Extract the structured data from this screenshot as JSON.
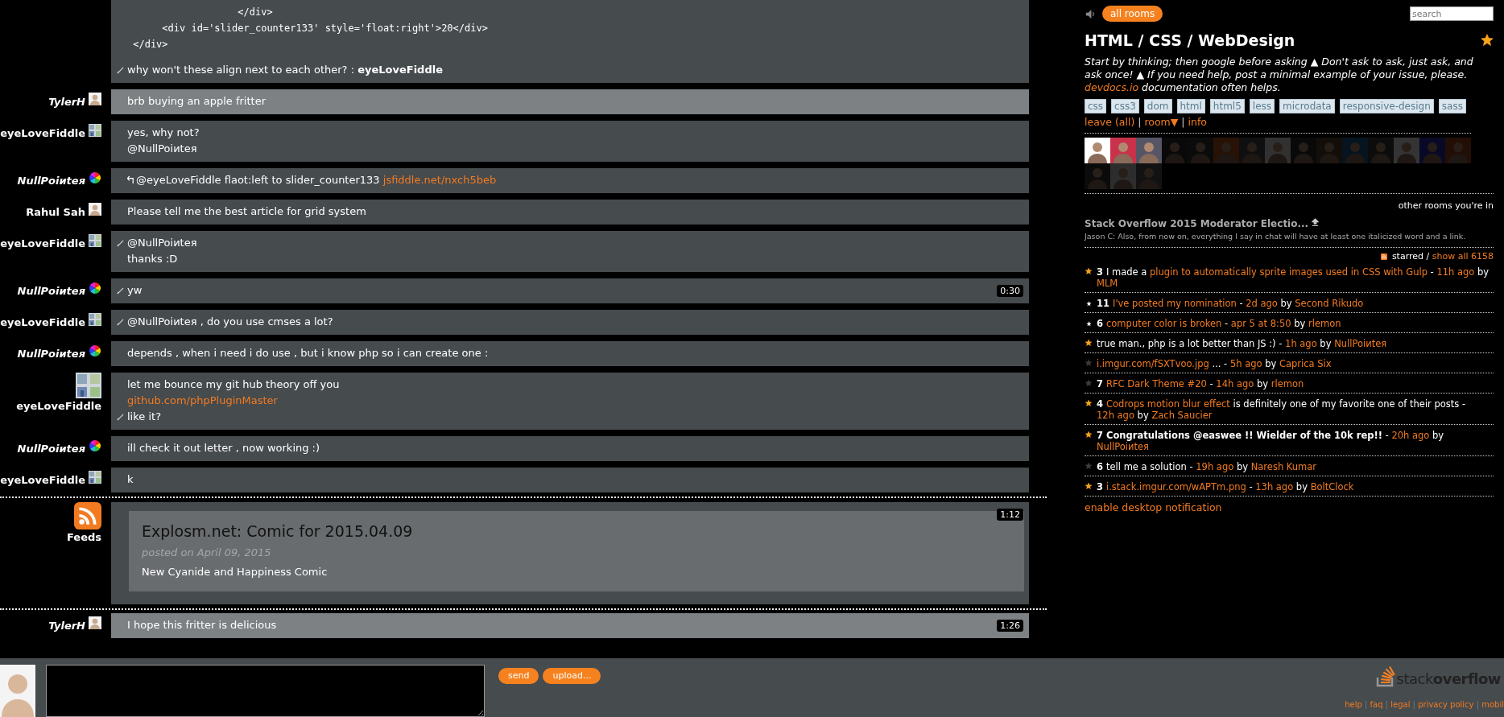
{
  "messages": [
    {
      "kind": "chat",
      "mine": false,
      "reply": false,
      "lines": [
        {
          "kind": "code",
          "edited": false,
          "parts": [
            {
              "text": "                   </div>",
              "link": false
            }
          ]
        },
        {
          "kind": "code",
          "edited": false,
          "parts": [
            {
              "text": "      <div id='slider_counter133' style='float:right'>20</div>",
              "link": false
            }
          ]
        },
        {
          "kind": "code",
          "edited": false,
          "parts": [
            {
              "text": " </div>",
              "link": false
            }
          ]
        },
        {
          "kind": "text",
          "edited": true,
          "parts": [
            {
              "text": "why won't these align next to each other? : **eyeLoveFiddle**",
              "link": false
            }
          ]
        }
      ]
    },
    {
      "kind": "chat",
      "user": "TylerH",
      "owner": true,
      "avatar": {
        "kind": "face"
      },
      "mine": true,
      "reply": false,
      "stacked": false,
      "lines": [
        {
          "kind": "text",
          "edited": false,
          "parts": [
            {
              "text": "brb buying an apple fritter",
              "link": false
            }
          ]
        }
      ]
    },
    {
      "kind": "chat",
      "user": "eyeLoveFiddle",
      "owner": false,
      "avatar": {
        "kind": "comic"
      },
      "mine": false,
      "reply": false,
      "stacked": false,
      "lines": [
        {
          "kind": "text",
          "edited": false,
          "parts": [
            {
              "text": "yes, why not?",
              "link": false
            }
          ]
        },
        {
          "kind": "text",
          "edited": false,
          "parts": [
            {
              "text": "@NullPoiиteя",
              "link": false
            }
          ]
        }
      ]
    },
    {
      "kind": "chat",
      "user": "NullPoiиteя",
      "owner": true,
      "avatar": {
        "kind": "wheel"
      },
      "mine": false,
      "reply": true,
      "stacked": false,
      "lines": [
        {
          "kind": "text",
          "edited": false,
          "parts": [
            {
              "text": "@eyeLoveFiddle flaot:left to slider_counter133 ",
              "link": false
            },
            {
              "text": "jsfiddle.net/nxch5beb",
              "link": true
            }
          ]
        }
      ]
    },
    {
      "kind": "chat",
      "user": "Rahul Sah",
      "owner": false,
      "avatar": {
        "kind": "face"
      },
      "mine": false,
      "reply": false,
      "stacked": false,
      "lines": [
        {
          "kind": "text",
          "edited": false,
          "parts": [
            {
              "text": "Please tell me the best article for grid system",
              "link": false
            }
          ]
        }
      ]
    },
    {
      "kind": "chat",
      "user": "eyeLoveFiddle",
      "owner": false,
      "avatar": {
        "kind": "comic"
      },
      "mine": false,
      "reply": false,
      "stacked": false,
      "lines": [
        {
          "kind": "text",
          "edited": true,
          "parts": [
            {
              "text": "@NullPoiиteя",
              "link": false
            }
          ]
        },
        {
          "kind": "text",
          "edited": false,
          "parts": [
            {
              "text": "thanks :D",
              "link": false
            }
          ]
        }
      ]
    },
    {
      "kind": "chat",
      "user": "NullPoiиteя",
      "owner": true,
      "avatar": {
        "kind": "wheel"
      },
      "mine": false,
      "reply": false,
      "stacked": false,
      "time": "0:30",
      "lines": [
        {
          "kind": "text",
          "edited": true,
          "parts": [
            {
              "text": "yw",
              "link": false
            }
          ]
        }
      ]
    },
    {
      "kind": "chat",
      "user": "eyeLoveFiddle",
      "owner": false,
      "avatar": {
        "kind": "comic"
      },
      "mine": false,
      "reply": false,
      "stacked": false,
      "lines": [
        {
          "kind": "text",
          "edited": true,
          "parts": [
            {
              "text": "@NullPoiиteя , do you use cmses a lot?",
              "link": false
            }
          ]
        }
      ]
    },
    {
      "kind": "chat",
      "user": "NullPoiиteя",
      "owner": true,
      "avatar": {
        "kind": "wheel"
      },
      "mine": false,
      "reply": false,
      "stacked": false,
      "lines": [
        {
          "kind": "text",
          "edited": false,
          "parts": [
            {
              "text": "depends , when i need i do use , but i know php so i can create one :",
              "link": false
            }
          ]
        }
      ]
    },
    {
      "kind": "chat",
      "user": "eyeLoveFiddle",
      "owner": false,
      "avatar": {
        "kind": "comic"
      },
      "mine": false,
      "reply": false,
      "stacked": true,
      "lines": [
        {
          "kind": "text",
          "edited": false,
          "parts": [
            {
              "text": "let me bounce my git hub theory off you",
              "link": false
            }
          ]
        },
        {
          "kind": "text",
          "edited": false,
          "parts": [
            {
              "text": "github.com/phpPluginMaster",
              "link": true
            }
          ]
        },
        {
          "kind": "text",
          "edited": true,
          "parts": [
            {
              "text": "like it?",
              "link": false
            }
          ]
        }
      ]
    },
    {
      "kind": "chat",
      "user": "NullPoiиteя",
      "owner": true,
      "avatar": {
        "kind": "wheel"
      },
      "mine": false,
      "reply": false,
      "stacked": false,
      "lines": [
        {
          "kind": "text",
          "edited": false,
          "parts": [
            {
              "text": "ill check it out letter , now working :)",
              "link": false
            }
          ]
        }
      ]
    },
    {
      "kind": "chat",
      "user": "eyeLoveFiddle",
      "owner": false,
      "avatar": {
        "kind": "comic"
      },
      "mine": false,
      "reply": false,
      "stacked": false,
      "lines": [
        {
          "kind": "text",
          "edited": false,
          "parts": [
            {
              "text": "k",
              "link": false
            }
          ]
        }
      ]
    },
    {
      "kind": "feed",
      "user": "Feeds",
      "owner": false,
      "avatar": {
        "kind": "rss"
      },
      "mine": false,
      "reply": false,
      "stacked": true,
      "time": "1:12",
      "feed": {
        "title": "Explosm.net: Comic for 2015.04.09",
        "posted": "posted on April 09, 2015",
        "body": "New Cyanide and Happiness Comic"
      }
    },
    {
      "kind": "chat",
      "user": "TylerH",
      "owner": true,
      "avatar": {
        "kind": "face"
      },
      "mine": true,
      "reply": false,
      "stacked": false,
      "time": "1:26",
      "lines": [
        {
          "kind": "text",
          "edited": false,
          "parts": [
            {
              "text": "I hope this fritter is delicious",
              "link": false
            }
          ]
        }
      ]
    }
  ],
  "sidebar": {
    "all_rooms": "all rooms",
    "search": {
      "placeholder": "search"
    },
    "room": {
      "title": "HTML / CSS / WebDesign",
      "favorite": true
    },
    "description": [
      {
        "text": "Start by thinking; then google before asking ▲ Don't ask to ask, just ask, and ask once! ▲ If you need help, post a minimal example of your issue, please. ",
        "link": false
      },
      {
        "text": "devdocs.io",
        "link": true
      },
      {
        "text": " documentation often helps.",
        "link": false
      }
    ],
    "tags": [
      "css",
      "css3",
      "dom",
      "html",
      "html5",
      "less",
      "microdata",
      "responsive-design",
      "sass"
    ],
    "room_actions": [
      {
        "text": "leave",
        "link": true
      },
      {
        "text": " (all) ",
        "link": true
      },
      {
        "text": "| ",
        "link": false
      },
      {
        "text": "room▼",
        "link": true
      },
      {
        "text": " | ",
        "link": false
      },
      {
        "text": "info",
        "link": true
      }
    ],
    "users": [
      {
        "present": true
      },
      {
        "present": true
      },
      {
        "present": true
      },
      {
        "present": false
      },
      {
        "present": false
      },
      {
        "present": false
      },
      {
        "present": false
      },
      {
        "present": false
      },
      {
        "present": false
      },
      {
        "present": false
      },
      {
        "present": false
      },
      {
        "present": false
      },
      {
        "present": false
      },
      {
        "present": false
      },
      {
        "present": false
      },
      {
        "present": false
      },
      {
        "present": false
      },
      {
        "present": false
      }
    ],
    "other_rooms_heading": "other rooms you're in",
    "other_rooms": [
      {
        "name": "Stack Overflow 2015 Moderator Electio...",
        "last_message": "Jason C: Also, from now on, everything I say in chat will have at least one italicized word and a link."
      }
    ],
    "starred_heading": [
      {
        "text": "starred / ",
        "link": false
      },
      {
        "text": "show all 6158",
        "link": true
      }
    ],
    "starred": [
      {
        "kind": "starred",
        "count": "3",
        "parts": [
          {
            "text": "I made a ",
            "link": false
          },
          {
            "text": "plugin to automatically sprite images used in CSS with Gulp",
            "link": true
          },
          {
            "text": " - ",
            "link": false
          },
          {
            "text": "11h ago",
            "link": true
          },
          {
            "text": " by ",
            "link": false
          },
          {
            "text": "MLM",
            "link": true
          }
        ]
      },
      {
        "kind": "pinned",
        "count": "11",
        "parts": [
          {
            "text": "I've posted my nomination",
            "link": true
          },
          {
            "text": " - ",
            "link": false
          },
          {
            "text": "2d ago",
            "link": true
          },
          {
            "text": " by ",
            "link": false
          },
          {
            "text": "Second Rikudo",
            "link": true
          }
        ]
      },
      {
        "kind": "pinned",
        "count": "6",
        "parts": [
          {
            "text": "computer color is broken",
            "link": true
          },
          {
            "text": " - ",
            "link": false
          },
          {
            "text": "apr 5 at 8:50",
            "link": true
          },
          {
            "text": " by ",
            "link": false
          },
          {
            "text": "rlemon",
            "link": true
          }
        ]
      },
      {
        "kind": "starred",
        "parts": [
          {
            "text": "true man., php is a lot better than JS :) - ",
            "link": false
          },
          {
            "text": "1h ago",
            "link": true
          },
          {
            "text": " by ",
            "link": false
          },
          {
            "text": "NullPoiиteя",
            "link": true
          }
        ]
      },
      {
        "kind": "other",
        "parts": [
          {
            "text": "i.imgur.com/fSXTvoo.jpg",
            "link": true
          },
          {
            "text": " ... - ",
            "link": false
          },
          {
            "text": "5h ago",
            "link": true
          },
          {
            "text": " by ",
            "link": false
          },
          {
            "text": "Caprica Six",
            "link": true
          }
        ]
      },
      {
        "kind": "other",
        "count": "7",
        "parts": [
          {
            "text": "RFC Dark Theme #20",
            "link": true
          },
          {
            "text": " - ",
            "link": false
          },
          {
            "text": "14h ago",
            "link": true
          },
          {
            "text": " by ",
            "link": false
          },
          {
            "text": "rlemon",
            "link": true
          }
        ]
      },
      {
        "kind": "starred",
        "count": "4",
        "parts": [
          {
            "text": "Codrops motion blur effect",
            "link": true
          },
          {
            "text": " is definitely one of my favorite one of their posts - ",
            "link": false
          },
          {
            "text": "12h ago",
            "link": true
          },
          {
            "text": " by ",
            "link": false
          },
          {
            "text": "Zach Saucier",
            "link": true
          }
        ]
      },
      {
        "kind": "starred",
        "count": "7",
        "parts": [
          {
            "text": "**Congratulations @easwee !! Wielder of the 10k rep!!** - ",
            "link": false
          },
          {
            "text": "20h ago",
            "link": true
          },
          {
            "text": " by ",
            "link": false
          },
          {
            "text": "NullPoiиteя",
            "link": true
          }
        ]
      },
      {
        "kind": "other",
        "count": "6",
        "parts": [
          {
            "text": "tell me a solution - ",
            "link": false
          },
          {
            "text": "19h ago",
            "link": true
          },
          {
            "text": " by ",
            "link": false
          },
          {
            "text": "Naresh Kumar",
            "link": true
          }
        ]
      },
      {
        "kind": "starred",
        "count": "3",
        "parts": [
          {
            "text": "i.stack.imgur.com/wAPTm.png",
            "link": true
          },
          {
            "text": " - ",
            "link": false
          },
          {
            "text": "13h ago",
            "link": true
          },
          {
            "text": " by ",
            "link": false
          },
          {
            "text": "BoltClock",
            "link": true
          }
        ]
      }
    ],
    "notification_link": "enable desktop notification"
  },
  "footer": {
    "buttons": [
      "send",
      "upload..."
    ],
    "logo": "stack**overflow**",
    "links": [
      {
        "text": "help",
        "link": true
      },
      {
        "text": " | ",
        "link": false
      },
      {
        "text": "faq",
        "link": true
      },
      {
        "text": " | ",
        "link": false
      },
      {
        "text": "legal",
        "link": true
      },
      {
        "text": " | ",
        "link": false
      },
      {
        "text": "privacy policy",
        "link": true
      },
      {
        "text": " | ",
        "link": false
      },
      {
        "text": "mobil",
        "link": true
      }
    ]
  }
}
